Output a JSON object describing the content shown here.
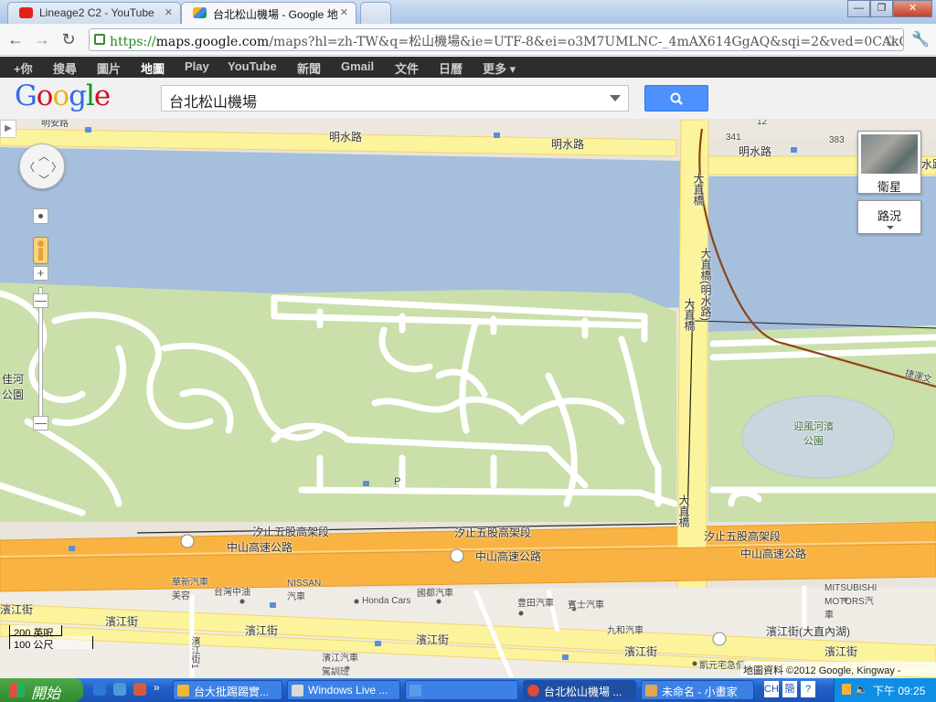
{
  "browser": {
    "tabs": [
      {
        "title": "Lineage2 C2 - YouTube",
        "icon": "youtube-icon",
        "active": false
      },
      {
        "title": "台北松山機場 - Google 地",
        "icon": "google-maps-icon",
        "active": true
      }
    ],
    "address": {
      "scheme": "https://",
      "host": "maps.google.com",
      "path": "/maps?hl=zh-TW&q=松山機場&ie=UTF-8&ei=o3M7UMLNC-_4mAX614GgAQ&sqi=2&ved=0CAkQ_AUo..."
    }
  },
  "gbar": {
    "items": [
      "+你",
      "搜尋",
      "圖片",
      "地圖",
      "Play",
      "YouTube",
      "新聞",
      "Gmail",
      "文件",
      "日曆",
      "更多 ▾"
    ],
    "selected_index": 3
  },
  "search": {
    "logo_letters": [
      "G",
      "o",
      "o",
      "g",
      "l",
      "e"
    ],
    "logo_colors": [
      "#3369e8",
      "#d50f25",
      "#eeb211",
      "#3369e8",
      "#009925",
      "#d50f25"
    ],
    "query": "台北松山機場",
    "button_color": "#4d90fe"
  },
  "map": {
    "labels": {
      "mingshui_road_1": "明水路",
      "mingshui_road_2": "明水路",
      "mingshui_road_3": "明水路",
      "mingshui_edge": "水路",
      "mingan_edge": "明安路",
      "num_12": "12",
      "num_341": "341",
      "num_383": "383",
      "dazhi_bridge_1": "大直橋",
      "dazhi_bridge_2": "大直橋",
      "dazhi_bridge_3": "大直橋(明水路)",
      "dazhi_bridge_4": "大直橋",
      "jiahe_park": "佳河公園",
      "yingfeng_park": "迎風河濱公園",
      "metro_line": "捷運文",
      "xizhi_expressway_1": "汐止五股高架段",
      "xizhi_expressway_2": "汐止五股高架段",
      "xizhi_expressway_3": "汐止五股高架段",
      "sun_yat_sen_1": "中山高速公路",
      "sun_yat_sen_2": "中山高速公路",
      "sun_yat_sen_3": "中山高速公路",
      "binjiang_1": "濱江街",
      "binjiang_2": "濱江街",
      "binjiang_3": "濱江街",
      "binjiang_4": "濱江街",
      "binjiang_5": "濱江街",
      "binjiang_6": "濱江街",
      "binjiang_7": "濱江街",
      "binjiang_neihu": "濱江街(大直內湖)",
      "binjiang_lane": "濱江街1",
      "huaxin": "華新汽車美容",
      "cpc": "台灣中油",
      "nissan": "NISSAN汽車",
      "honda": "Honda Cars",
      "guodu": "國都汽車",
      "toyota": "豊田汽車",
      "benz": "賓士汽車",
      "jiuhe": "九和汽車",
      "mitsubishi": "MITSUBISHI MOTORS汽車",
      "driving_school": "濱江汽車駕訓班",
      "kaiyuan": "凱元宅急便",
      "parking": "P",
      "shield_1": "1"
    },
    "layer_satellite": "衛星",
    "layer_traffic": "路況",
    "scale_imperial": "200 英呎",
    "scale_metric": "100 公尺",
    "copyright": "地圖資料 ©2012 Google, Kingway -"
  },
  "taskbar": {
    "start": "開始",
    "items": [
      {
        "label": "台大批踢踢實...",
        "color": "#f2b632",
        "active": false
      },
      {
        "label": "Windows Live ...",
        "color": "#d9d9d9",
        "active": false
      },
      {
        "label": "",
        "color": "#5a9be8",
        "active": false
      },
      {
        "label": "台北松山機場 ...",
        "color": "#de4a39",
        "active": true
      },
      {
        "label": "未命名 - 小畫家",
        "color": "#e0a84a",
        "active": false
      }
    ],
    "ime_1": "CH",
    "ime_2": "簡",
    "ime_3": "?",
    "clock": "下午 09:25"
  }
}
